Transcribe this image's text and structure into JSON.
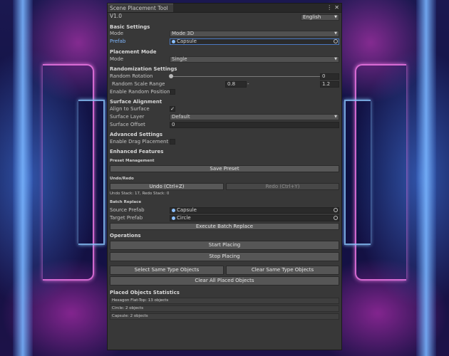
{
  "window": {
    "title": "Scene Placement Tool V1.0",
    "language": "English"
  },
  "basic": {
    "header": "Basic Settings",
    "mode_label": "Mode",
    "mode_value": "Mode 3D",
    "prefab_label": "Prefab",
    "prefab_value": "Capsule"
  },
  "placement": {
    "header": "Placement Mode",
    "mode_label": "Mode",
    "mode_value": "Single"
  },
  "randomization": {
    "header": "Randomization Settings",
    "rotation_label": "Random Rotation",
    "rotation_value": "0",
    "rotation_level": 0,
    "scale_label": "Random Scale Range",
    "scale_min": "0.8",
    "scale_dash": "-",
    "scale_max": "1.2",
    "position_label": "Enable Random Position",
    "position_checked": false
  },
  "surface": {
    "header": "Surface Alignment",
    "align_label": "Align to Surface",
    "align_checked": true,
    "layer_label": "Surface Layer",
    "layer_value": "Default",
    "offset_label": "Surface Offset",
    "offset_value": "0"
  },
  "advanced": {
    "header": "Advanced Settings",
    "drag_label": "Enable Drag Placement",
    "drag_checked": false
  },
  "enhanced": {
    "header": "Enhanced Features",
    "preset_header": "Preset Management",
    "save_preset": "Save Preset",
    "undo_header": "Undo/Redo",
    "undo": "Undo (Ctrl+Z)",
    "redo": "Redo (Ctrl+Y)",
    "stack_info": "Undo Stack: 17, Redo Stack: 0",
    "batch_header": "Batch Replace",
    "source_label": "Source Prefab",
    "source_value": "Capsule",
    "target_label": "Target Prefab",
    "target_value": "Circle",
    "execute": "Execute Batch Replace"
  },
  "operations": {
    "header": "Operations",
    "start": "Start Placing",
    "stop": "Stop Placing",
    "select_same": "Select Same Type Objects",
    "clear_same": "Clear Same Type Objects",
    "clear_all": "Clear All Placed Objects"
  },
  "statistics": {
    "header": "Placed Objects Statistics",
    "items": [
      "Hexagon Flat-Top: 13 objects",
      "Circle: 2 objects",
      "Capsule: 2 objects"
    ]
  },
  "icons": {
    "menu": "kebab-menu-icon",
    "close": "close-icon",
    "object": "prefab-icon",
    "picker": "object-picker-icon",
    "dropdown": "chevron-down-icon"
  },
  "colors": {
    "panel": "#383838",
    "field": "#2a2a2a",
    "button": "#585858",
    "link": "#7fb7ff"
  }
}
